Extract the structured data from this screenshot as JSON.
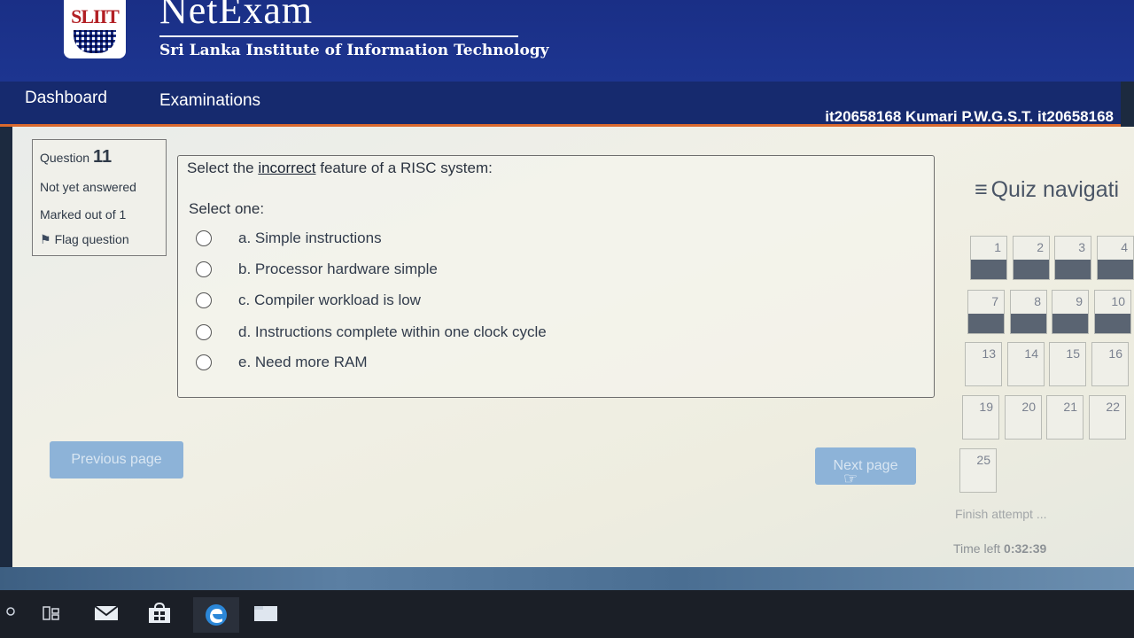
{
  "header": {
    "logo_text": "SLIIT",
    "brand": "NetExam",
    "institute": "Sri Lanka Institute of Information Technology"
  },
  "nav": {
    "dashboard": "Dashboard",
    "examinations": "Examinations",
    "user": "it20658168 Kumari P.W.G.S.T. it20658168"
  },
  "question_info": {
    "label": "Question",
    "number": "11",
    "status": "Not yet answered",
    "marks": "Marked out of 1",
    "flag": "Flag question"
  },
  "question": {
    "text_before": "Select the ",
    "text_emph": "incorrect",
    "text_after": " feature of a RISC system:",
    "prompt": "Select one:",
    "options": [
      "a. Simple instructions",
      "b. Processor hardware simple",
      "c. Compiler workload is low",
      "d. Instructions complete within one clock cycle",
      "e. Need more RAM"
    ]
  },
  "buttons": {
    "previous": "Previous page",
    "next": "Next page"
  },
  "quiz_nav": {
    "title": "Quiz navigati",
    "tiles": [
      "1",
      "2",
      "3",
      "4",
      "7",
      "8",
      "9",
      "10",
      "13",
      "14",
      "15",
      "16",
      "19",
      "20",
      "21",
      "22",
      "25"
    ],
    "answered": [
      "1",
      "2",
      "3",
      "4",
      "7",
      "8",
      "9",
      "10"
    ],
    "finish": "Finish attempt ...",
    "time_label": "Time left",
    "time_value": "0:32:39"
  },
  "taskbar": {
    "icons": [
      "search-icon",
      "task-view-icon",
      "mail-icon",
      "store-icon",
      "edge-icon",
      "file-explorer-icon"
    ]
  }
}
